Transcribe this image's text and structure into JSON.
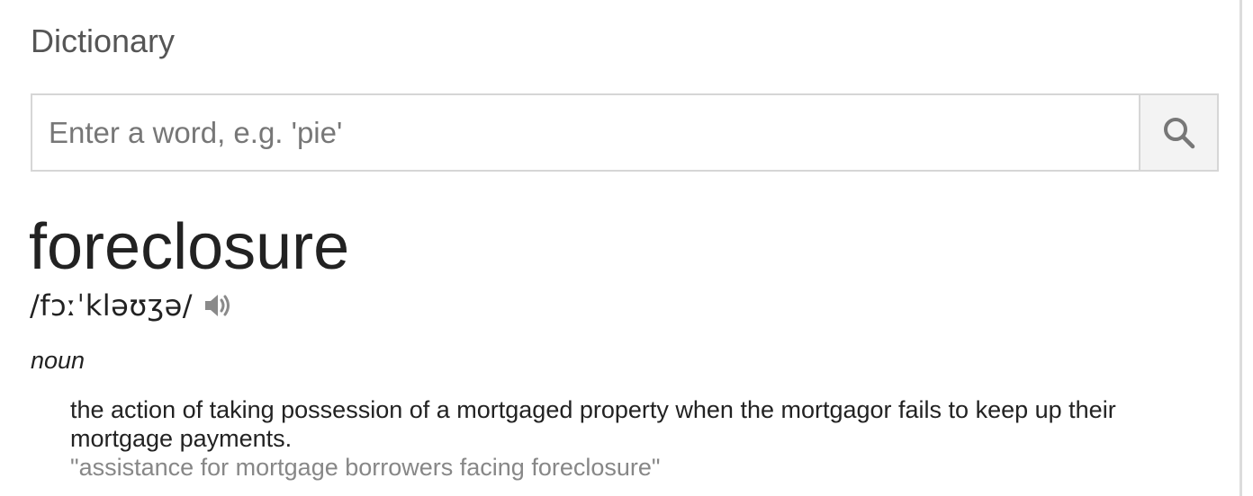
{
  "header": {
    "title": "Dictionary"
  },
  "search": {
    "placeholder": "Enter a word, e.g. 'pie'",
    "value": "",
    "button_icon": "search-icon"
  },
  "entry": {
    "word": "foreclosure",
    "pronunciation": "/fɔːˈkləʊʒə/",
    "audio_icon": "speaker-icon",
    "part_of_speech": "noun",
    "definition": "the action of taking possession of a mortgaged property when the mortgagor fails to keep up their mortgage payments.",
    "example": "\"assistance for mortgage borrowers facing foreclosure\""
  },
  "colors": {
    "title": "#555555",
    "text": "#222222",
    "example": "#878787",
    "border": "#d6d6d6",
    "button_bg": "#f3f3f3"
  }
}
